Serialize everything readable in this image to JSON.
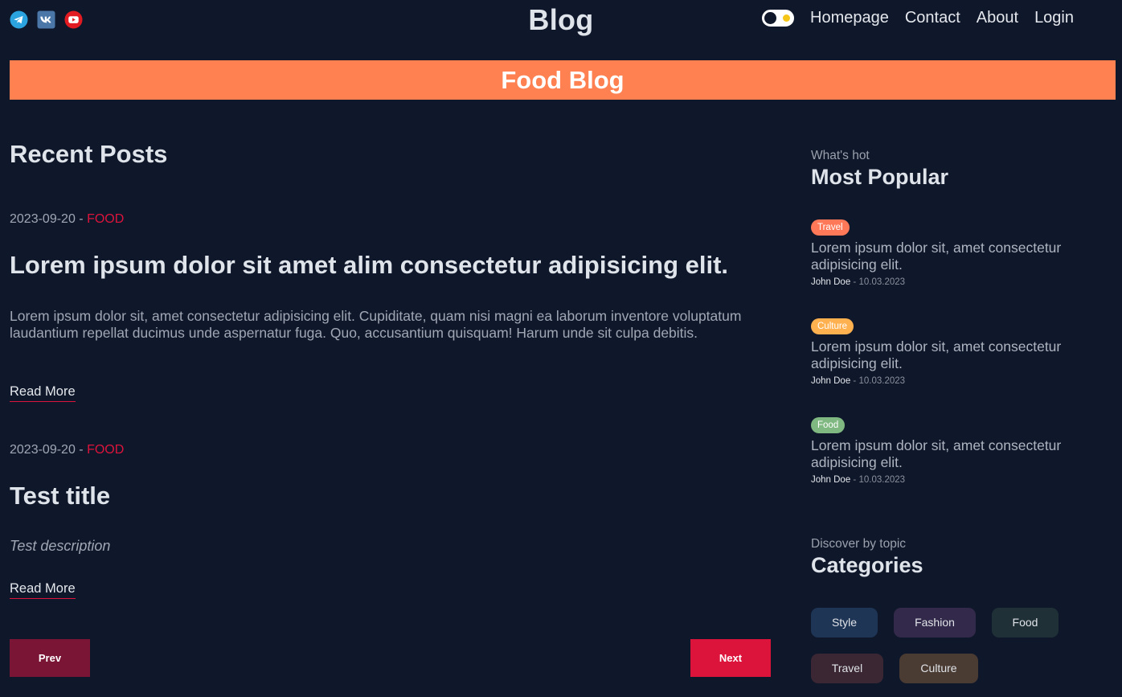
{
  "navbar": {
    "social": [
      "telegram-icon",
      "vk-icon",
      "youtube-icon"
    ],
    "logo": "Blog",
    "links": [
      "Homepage",
      "Contact",
      "About",
      "Login"
    ]
  },
  "banner": {
    "title": "Food Blog"
  },
  "main": {
    "heading": "Recent Posts",
    "posts": [
      {
        "date": "2023-09-20",
        "separator": " - ",
        "category": "FOOD",
        "title": "Lorem ipsum dolor sit amet alim consectetur adipisicing elit.",
        "description": "Lorem ipsum dolor sit, amet consectetur adipisicing elit. Cupiditate, quam nisi magni ea laborum inventore voluptatum laudantium repellat ducimus unde aspernatur fuga. Quo, accusantium quisquam! Harum unde sit culpa debitis.",
        "read_more": "Read More"
      },
      {
        "date": "2023-09-20",
        "separator": " - ",
        "category": "FOOD",
        "title": "Test title",
        "description": "Test description",
        "read_more": "Read More"
      }
    ],
    "pagination": {
      "prev": "Prev",
      "next": "Next"
    }
  },
  "sidebar": {
    "popular": {
      "subtitle": "What's hot",
      "title": "Most Popular",
      "items": [
        {
          "tag": "Travel",
          "tag_color": "#ff7857",
          "title": "Lorem ipsum dolor sit, amet consectetur adipisicing elit.",
          "author": "John Doe",
          "separator": " - ",
          "date": "10.03.2023"
        },
        {
          "tag": "Culture",
          "tag_color": "#ffb04f",
          "title": "Lorem ipsum dolor sit, amet consectetur adipisicing elit.",
          "author": "John Doe",
          "separator": " - ",
          "date": "10.03.2023"
        },
        {
          "tag": "Food",
          "tag_color": "#7fb881",
          "title": "Lorem ipsum dolor sit, amet consectetur adipisicing elit.",
          "author": "John Doe",
          "separator": " - ",
          "date": "10.03.2023"
        }
      ]
    },
    "categories": {
      "subtitle": "Discover by topic",
      "title": "Categories",
      "items": [
        {
          "label": "Style",
          "color": "#1f3556"
        },
        {
          "label": "Fashion",
          "color": "#33294a"
        },
        {
          "label": "Food",
          "color": "#1f3137"
        },
        {
          "label": "Travel",
          "color": "#3a2733"
        },
        {
          "label": "Culture",
          "color": "#4a3b33"
        }
      ]
    }
  }
}
